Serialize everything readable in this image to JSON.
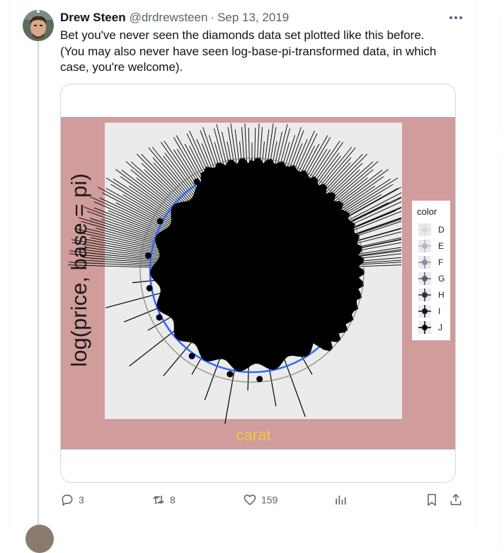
{
  "tweet": {
    "author_name": "Drew Steen",
    "author_handle": "@drdrewsteen",
    "separator": "·",
    "date": "Sep 13, 2019",
    "text_lines": [
      "Bet you've never seen the diamonds data set plotted like this before.",
      "(You may also never have seen log-base-pi-transformed data, in which",
      "case, you're welcome)."
    ]
  },
  "chart_data": {
    "type": "scatter",
    "title": "",
    "xlabel": "carat",
    "ylabel": "log(price, base = pi)",
    "coord": "polar",
    "grid": true,
    "legend": {
      "title": "color",
      "placement": "right",
      "entries": [
        "D",
        "E",
        "F",
        "G",
        "H",
        "I",
        "J"
      ]
    },
    "colors": {
      "background": "#d09c9c",
      "panel": "#ebebeb",
      "xlabel": "#f5c64a",
      "marks": "#000000",
      "smooth": "#3366ff"
    }
  },
  "actions": {
    "reply_count": "3",
    "retweet_count": "8",
    "like_count": "159"
  }
}
